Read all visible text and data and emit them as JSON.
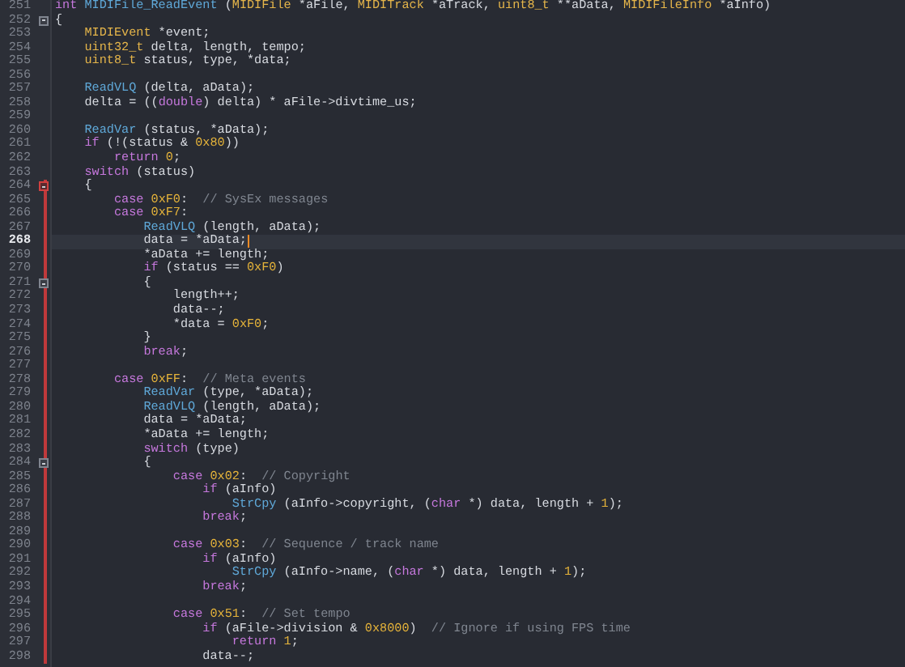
{
  "editor": {
    "lines": [
      {
        "number": "251",
        "current": false,
        "fold_marker": false,
        "scope": false,
        "tokens": [
          {
            "kind": "keyword",
            "text": "int"
          },
          {
            "kind": "function",
            "text": " MIDIFile_ReadEvent"
          },
          {
            "kind": "plain",
            "text": " ("
          },
          {
            "kind": "type",
            "text": "MIDIFile"
          },
          {
            "kind": "plain",
            "text": " *aFile, "
          },
          {
            "kind": "type",
            "text": "MIDITrack"
          },
          {
            "kind": "plain",
            "text": " *aTrack, "
          },
          {
            "kind": "type",
            "text": "uint8_t"
          },
          {
            "kind": "plain",
            "text": " **aData, "
          },
          {
            "kind": "type",
            "text": "MIDIFileInfo"
          },
          {
            "kind": "plain",
            "text": " *aInfo)"
          }
        ]
      },
      {
        "number": "252",
        "current": false,
        "fold_marker": true,
        "scope": false,
        "tokens": [
          {
            "kind": "plain",
            "text": "{"
          }
        ]
      },
      {
        "number": "253",
        "current": false,
        "fold_marker": false,
        "scope": false,
        "tokens": [
          {
            "kind": "type",
            "text": "    MIDIEvent"
          },
          {
            "kind": "plain",
            "text": " *event;"
          }
        ]
      },
      {
        "number": "254",
        "current": false,
        "fold_marker": false,
        "scope": false,
        "tokens": [
          {
            "kind": "type",
            "text": "    uint32_t"
          },
          {
            "kind": "plain",
            "text": " delta, length, tempo;"
          }
        ]
      },
      {
        "number": "255",
        "current": false,
        "fold_marker": false,
        "scope": false,
        "tokens": [
          {
            "kind": "type",
            "text": "    uint8_t"
          },
          {
            "kind": "plain",
            "text": " status, type, *data;"
          }
        ]
      },
      {
        "number": "256",
        "current": false,
        "fold_marker": false,
        "scope": false
      },
      {
        "number": "257",
        "current": false,
        "fold_marker": false,
        "scope": false,
        "tokens": [
          {
            "kind": "function",
            "text": "    ReadVLQ"
          },
          {
            "kind": "plain",
            "text": " (delta, aData);"
          }
        ]
      },
      {
        "number": "258",
        "current": false,
        "fold_marker": false,
        "scope": false,
        "tokens": [
          {
            "kind": "plain",
            "text": "    delta = (("
          },
          {
            "kind": "keyword",
            "text": "double"
          },
          {
            "kind": "plain",
            "text": ") delta) * aFile->divtime_us;"
          }
        ]
      },
      {
        "number": "259",
        "current": false,
        "fold_marker": false,
        "scope": false
      },
      {
        "number": "260",
        "current": false,
        "fold_marker": false,
        "scope": false,
        "tokens": [
          {
            "kind": "function",
            "text": "    ReadVar"
          },
          {
            "kind": "plain",
            "text": " (status, *aData);"
          }
        ]
      },
      {
        "number": "261",
        "current": false,
        "fold_marker": false,
        "scope": false,
        "tokens": [
          {
            "kind": "keyword",
            "text": "    if"
          },
          {
            "kind": "plain",
            "text": " (!(status & "
          },
          {
            "kind": "number",
            "text": "0x80"
          },
          {
            "kind": "plain",
            "text": "))"
          }
        ]
      },
      {
        "number": "262",
        "current": false,
        "fold_marker": false,
        "scope": false,
        "tokens": [
          {
            "kind": "keyword",
            "text": "        return"
          },
          {
            "kind": "number",
            "text": " 0"
          },
          {
            "kind": "plain",
            "text": ";"
          }
        ]
      },
      {
        "number": "263",
        "current": false,
        "fold_marker": false,
        "scope": false,
        "tokens": [
          {
            "kind": "keyword",
            "text": "    switch"
          },
          {
            "kind": "plain",
            "text": " (status)"
          }
        ]
      },
      {
        "number": "264",
        "current": false,
        "fold_marker": true,
        "scope": true,
        "tokens": [
          {
            "kind": "plain",
            "text": "    {"
          }
        ]
      },
      {
        "number": "265",
        "current": false,
        "fold_marker": false,
        "scope": true,
        "tokens": [
          {
            "kind": "keyword",
            "text": "        case"
          },
          {
            "kind": "number",
            "text": " 0xF0"
          },
          {
            "kind": "plain",
            "text": ":  "
          },
          {
            "kind": "comment",
            "text": "// SysEx messages"
          }
        ]
      },
      {
        "number": "266",
        "current": false,
        "fold_marker": false,
        "scope": true,
        "tokens": [
          {
            "kind": "keyword",
            "text": "        case"
          },
          {
            "kind": "number",
            "text": " 0xF7"
          },
          {
            "kind": "plain",
            "text": ":"
          }
        ]
      },
      {
        "number": "267",
        "current": false,
        "fold_marker": false,
        "scope": true,
        "tokens": [
          {
            "kind": "function",
            "text": "            ReadVLQ"
          },
          {
            "kind": "plain",
            "text": " (length, aData);"
          }
        ]
      },
      {
        "number": "268",
        "current": true,
        "fold_marker": false,
        "scope": true,
        "tokens": [
          {
            "kind": "plain",
            "text": "            data = *aData;"
          }
        ]
      },
      {
        "number": "269",
        "current": false,
        "fold_marker": false,
        "scope": true,
        "tokens": [
          {
            "kind": "plain",
            "text": "            *aData += length;"
          }
        ]
      },
      {
        "number": "270",
        "current": false,
        "fold_marker": false,
        "scope": true,
        "tokens": [
          {
            "kind": "keyword",
            "text": "            if"
          },
          {
            "kind": "plain",
            "text": " (status == "
          },
          {
            "kind": "number",
            "text": "0xF0"
          },
          {
            "kind": "plain",
            "text": ")"
          }
        ]
      },
      {
        "number": "271",
        "current": false,
        "fold_marker": true,
        "scope": true,
        "tokens": [
          {
            "kind": "plain",
            "text": "            {"
          }
        ]
      },
      {
        "number": "272",
        "current": false,
        "fold_marker": false,
        "scope": true,
        "tokens": [
          {
            "kind": "plain",
            "text": "                length++;"
          }
        ]
      },
      {
        "number": "273",
        "current": false,
        "fold_marker": false,
        "scope": true,
        "tokens": [
          {
            "kind": "plain",
            "text": "                data--;"
          }
        ]
      },
      {
        "number": "274",
        "current": false,
        "fold_marker": false,
        "scope": true,
        "tokens": [
          {
            "kind": "plain",
            "text": "                *data = "
          },
          {
            "kind": "number",
            "text": "0xF0"
          },
          {
            "kind": "plain",
            "text": ";"
          }
        ]
      },
      {
        "number": "275",
        "current": false,
        "fold_marker": false,
        "scope": true,
        "tokens": [
          {
            "kind": "plain",
            "text": "            }"
          }
        ]
      },
      {
        "number": "276",
        "current": false,
        "fold_marker": false,
        "scope": true,
        "tokens": [
          {
            "kind": "keyword",
            "text": "            break"
          },
          {
            "kind": "plain",
            "text": ";"
          }
        ]
      },
      {
        "number": "277",
        "current": false,
        "fold_marker": false,
        "scope": true
      },
      {
        "number": "278",
        "current": false,
        "fold_marker": false,
        "scope": true,
        "tokens": [
          {
            "kind": "keyword",
            "text": "        case"
          },
          {
            "kind": "number",
            "text": " 0xFF"
          },
          {
            "kind": "plain",
            "text": ":  "
          },
          {
            "kind": "comment",
            "text": "// Meta events"
          }
        ]
      },
      {
        "number": "279",
        "current": false,
        "fold_marker": false,
        "scope": true,
        "tokens": [
          {
            "kind": "function",
            "text": "            ReadVar"
          },
          {
            "kind": "plain",
            "text": " (type, *aData);"
          }
        ]
      },
      {
        "number": "280",
        "current": false,
        "fold_marker": false,
        "scope": true,
        "tokens": [
          {
            "kind": "function",
            "text": "            ReadVLQ"
          },
          {
            "kind": "plain",
            "text": " (length, aData);"
          }
        ]
      },
      {
        "number": "281",
        "current": false,
        "fold_marker": false,
        "scope": true,
        "tokens": [
          {
            "kind": "plain",
            "text": "            data = *aData;"
          }
        ]
      },
      {
        "number": "282",
        "current": false,
        "fold_marker": false,
        "scope": true,
        "tokens": [
          {
            "kind": "plain",
            "text": "            *aData += length;"
          }
        ]
      },
      {
        "number": "283",
        "current": false,
        "fold_marker": false,
        "scope": true,
        "tokens": [
          {
            "kind": "keyword",
            "text": "            switch"
          },
          {
            "kind": "plain",
            "text": " (type)"
          }
        ]
      },
      {
        "number": "284",
        "current": false,
        "fold_marker": true,
        "scope": true,
        "tokens": [
          {
            "kind": "plain",
            "text": "            {"
          }
        ]
      },
      {
        "number": "285",
        "current": false,
        "fold_marker": false,
        "scope": true,
        "tokens": [
          {
            "kind": "keyword",
            "text": "                case"
          },
          {
            "kind": "number",
            "text": " 0x02"
          },
          {
            "kind": "plain",
            "text": ":  "
          },
          {
            "kind": "comment",
            "text": "// Copyright"
          }
        ]
      },
      {
        "number": "286",
        "current": false,
        "fold_marker": false,
        "scope": true,
        "tokens": [
          {
            "kind": "keyword",
            "text": "                    if"
          },
          {
            "kind": "plain",
            "text": " (aInfo)"
          }
        ]
      },
      {
        "number": "287",
        "current": false,
        "fold_marker": false,
        "scope": true,
        "tokens": [
          {
            "kind": "function",
            "text": "                        StrCpy"
          },
          {
            "kind": "plain",
            "text": " (aInfo->copyright, ("
          },
          {
            "kind": "keyword",
            "text": "char"
          },
          {
            "kind": "plain",
            "text": " *) data, length + "
          },
          {
            "kind": "number",
            "text": "1"
          },
          {
            "kind": "plain",
            "text": ");"
          }
        ]
      },
      {
        "number": "288",
        "current": false,
        "fold_marker": false,
        "scope": true,
        "tokens": [
          {
            "kind": "keyword",
            "text": "                    break"
          },
          {
            "kind": "plain",
            "text": ";"
          }
        ]
      },
      {
        "number": "289",
        "current": false,
        "fold_marker": false,
        "scope": true
      },
      {
        "number": "290",
        "current": false,
        "fold_marker": false,
        "scope": true,
        "tokens": [
          {
            "kind": "keyword",
            "text": "                case"
          },
          {
            "kind": "number",
            "text": " 0x03"
          },
          {
            "kind": "plain",
            "text": ":  "
          },
          {
            "kind": "comment",
            "text": "// Sequence / track name"
          }
        ]
      },
      {
        "number": "291",
        "current": false,
        "fold_marker": false,
        "scope": true,
        "tokens": [
          {
            "kind": "keyword",
            "text": "                    if"
          },
          {
            "kind": "plain",
            "text": " (aInfo)"
          }
        ]
      },
      {
        "number": "292",
        "current": false,
        "fold_marker": false,
        "scope": true,
        "tokens": [
          {
            "kind": "function",
            "text": "                        StrCpy"
          },
          {
            "kind": "plain",
            "text": " (aInfo->name, ("
          },
          {
            "kind": "keyword",
            "text": "char"
          },
          {
            "kind": "plain",
            "text": " *) data, length + "
          },
          {
            "kind": "number",
            "text": "1"
          },
          {
            "kind": "plain",
            "text": ");"
          }
        ]
      },
      {
        "number": "293",
        "current": false,
        "fold_marker": false,
        "scope": true,
        "tokens": [
          {
            "kind": "keyword",
            "text": "                    break"
          },
          {
            "kind": "plain",
            "text": ";"
          }
        ]
      },
      {
        "number": "294",
        "current": false,
        "fold_marker": false,
        "scope": true
      },
      {
        "number": "295",
        "current": false,
        "fold_marker": false,
        "scope": true,
        "tokens": [
          {
            "kind": "keyword",
            "text": "                case"
          },
          {
            "kind": "number",
            "text": " 0x51"
          },
          {
            "kind": "plain",
            "text": ":  "
          },
          {
            "kind": "comment",
            "text": "// Set tempo"
          }
        ]
      },
      {
        "number": "296",
        "current": false,
        "fold_marker": false,
        "scope": true,
        "tokens": [
          {
            "kind": "keyword",
            "text": "                    if"
          },
          {
            "kind": "plain",
            "text": " (aFile->division & "
          },
          {
            "kind": "number",
            "text": "0x8000"
          },
          {
            "kind": "plain",
            "text": ")  "
          },
          {
            "kind": "comment",
            "text": "// Ignore if using FPS time"
          }
        ]
      },
      {
        "number": "297",
        "current": false,
        "fold_marker": false,
        "scope": true,
        "tokens": [
          {
            "kind": "keyword",
            "text": "                        return"
          },
          {
            "kind": "number",
            "text": " 1"
          },
          {
            "kind": "plain",
            "text": ";"
          }
        ]
      },
      {
        "number": "298",
        "current": false,
        "fold_marker": false,
        "scope": true,
        "tokens": [
          {
            "kind": "plain",
            "text": "                    data--;"
          }
        ]
      }
    ]
  }
}
